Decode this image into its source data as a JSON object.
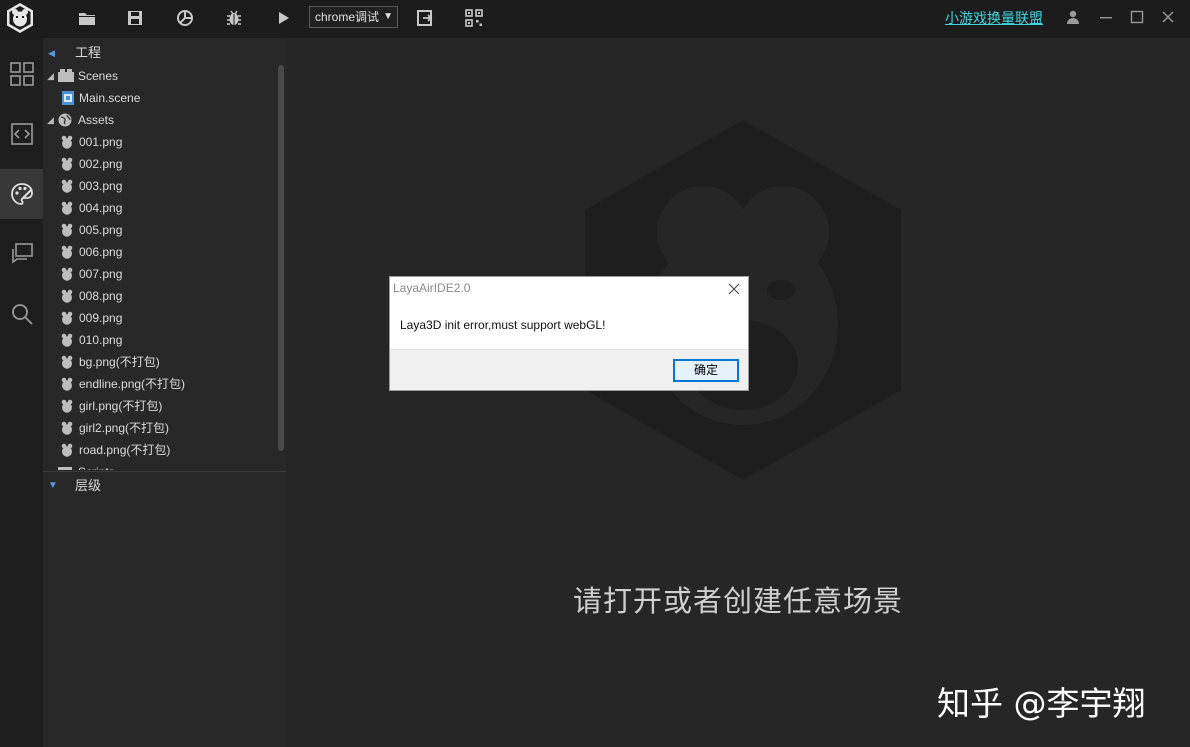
{
  "toolbar": {
    "run_target": "chrome调试",
    "union_link": "小游戏换量联盟",
    "icons": [
      "folder-icon",
      "save-icon",
      "publish-icon",
      "debug-bug-icon",
      "play-icon",
      "export-icon",
      "qr-code-icon"
    ]
  },
  "sidebar": {
    "items": [
      "layout-grid-icon",
      "code-icon",
      "palette-icon",
      "chat-icon",
      "search-icon"
    ],
    "active": "palette-icon"
  },
  "project_panel": {
    "title": "工程",
    "scenes_label": "Scenes",
    "scene_file": "Main.scene",
    "assets_label": "Assets",
    "assets": [
      "001.png",
      "002.png",
      "003.png",
      "004.png",
      "005.png",
      "006.png",
      "007.png",
      "008.png",
      "009.png",
      "010.png",
      "bg.png(不打包)",
      "endline.png(不打包)",
      "girl.png(不打包)",
      "girl2.png(不打包)",
      "road.png(不打包)"
    ],
    "scripts_label": "Scripts"
  },
  "hierarchy_panel": {
    "title": "层级"
  },
  "main": {
    "empty_message": "请打开或者创建任意场景",
    "watermark": "知乎 @李宇翔"
  },
  "dialog": {
    "title": "LayaAirIDE2.0",
    "message": "Laya3D init error,must support webGL!",
    "ok_label": "确定"
  },
  "colors": {
    "accent": "#3bd6e0",
    "tree_arrow": "#4d9be8",
    "dialog_button_border": "#0078d7"
  }
}
